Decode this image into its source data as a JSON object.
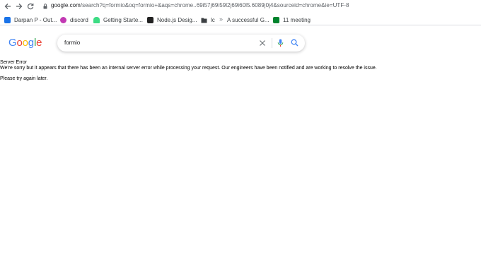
{
  "browser": {
    "url_host": "google.com",
    "url_rest": "/search?q=formio&oq=formio+&aqs=chrome..69i57j69i59l2j69i60l5.6089j0j4&sourceid=chrome&ie=UTF-8"
  },
  "bookmarks": [
    {
      "label": "Darpan P - Out...",
      "icon": "outlook-icon",
      "color": "#1a73e8"
    },
    {
      "label": "discord",
      "icon": "discord-icon",
      "color": "#c239b3"
    },
    {
      "label": "Getting Starte...",
      "icon": "android-icon",
      "color": "#3ddc84"
    },
    {
      "label": "Node.js Desig...",
      "icon": "nodejs-icon",
      "color": "#222222"
    },
    {
      "label": "lc",
      "icon": "folder-icon",
      "color": "#3c4043"
    },
    {
      "label": "A successful G...",
      "icon": "page-icon",
      "color": "#5f6368"
    },
    {
      "label": "11 meeting",
      "icon": "meet-icon",
      "color": "#00832d"
    }
  ],
  "google": {
    "logo_letters": [
      "G",
      "o",
      "o",
      "g",
      "l",
      "e"
    ],
    "logo_colors": [
      "#4285F4",
      "#EA4335",
      "#FBBC05",
      "#4285F4",
      "#34A853",
      "#EA4335"
    ],
    "query": "formio"
  },
  "error": {
    "title": "Server Error",
    "message": "We're sorry but it appears that there has been an internal server error while processing your request. Our engineers have been notified and are working to resolve the issue.",
    "retry": "Please try again later."
  }
}
